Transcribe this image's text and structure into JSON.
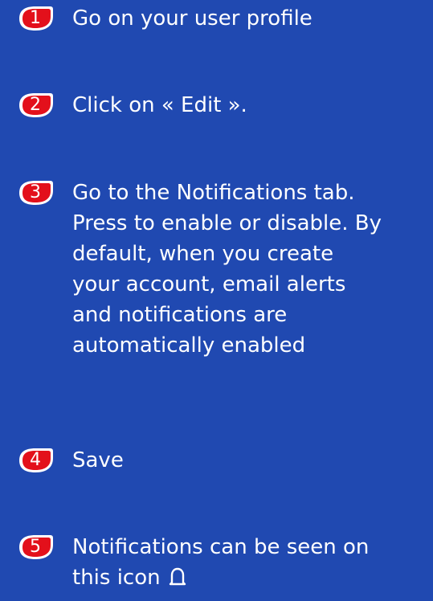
{
  "steps": [
    {
      "number": "1",
      "text": "Go on your user profile"
    },
    {
      "number": "2",
      "text": "Click on « Edit »."
    },
    {
      "number": "3",
      "text": "Go to the Notifications tab.\nPress to enable or disable. By\ndefault, when you create\nyour account, email alerts\nand notifications are\nautomatically enabled"
    },
    {
      "number": "4",
      "text": "Save"
    },
    {
      "number": "5",
      "text": "Notifications can be seen on\nthis icon"
    }
  ],
  "colors": {
    "background": "#2049b1",
    "badge_fill": "#e3101b",
    "badge_outline": "#ffffff",
    "text": "#ffffff"
  },
  "icons": {
    "step_5_inline": "bell-icon"
  }
}
